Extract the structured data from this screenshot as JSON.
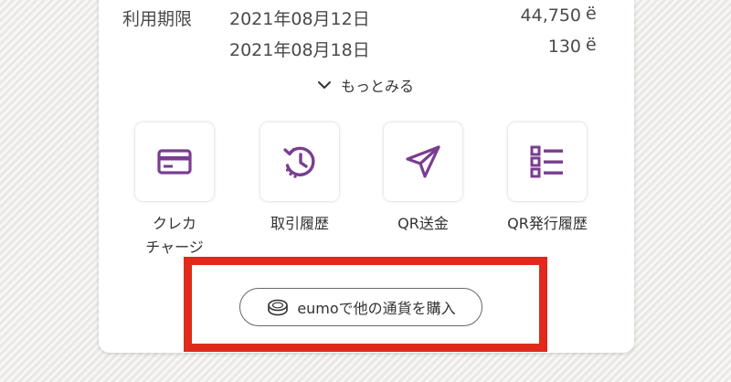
{
  "balances": {
    "expiry_label": "利用期限",
    "rows": [
      {
        "date": "2021年08月12日",
        "amount": "44,750",
        "currency": "ë"
      },
      {
        "date": "2021年08月18日",
        "amount": "130",
        "currency": "ë"
      }
    ]
  },
  "more": {
    "label": "もっとみる",
    "icon": "chevron-down-icon"
  },
  "actions": [
    {
      "label_line1": "クレカ",
      "label_line2": "チャージ",
      "icon": "credit-card-icon"
    },
    {
      "label_line1": "取引履歴",
      "label_line2": "",
      "icon": "history-icon"
    },
    {
      "label_line1": "QR送金",
      "label_line2": "",
      "icon": "send-icon"
    },
    {
      "label_line1": "QR発行履歴",
      "label_line2": "",
      "icon": "list-icon"
    }
  ],
  "buy_button": {
    "label": "eumoで他の通貨を購入",
    "icon": "coin-icon"
  },
  "colors": {
    "accent": "#7a3d91",
    "highlight": "#e02a1b",
    "text": "#333333"
  }
}
